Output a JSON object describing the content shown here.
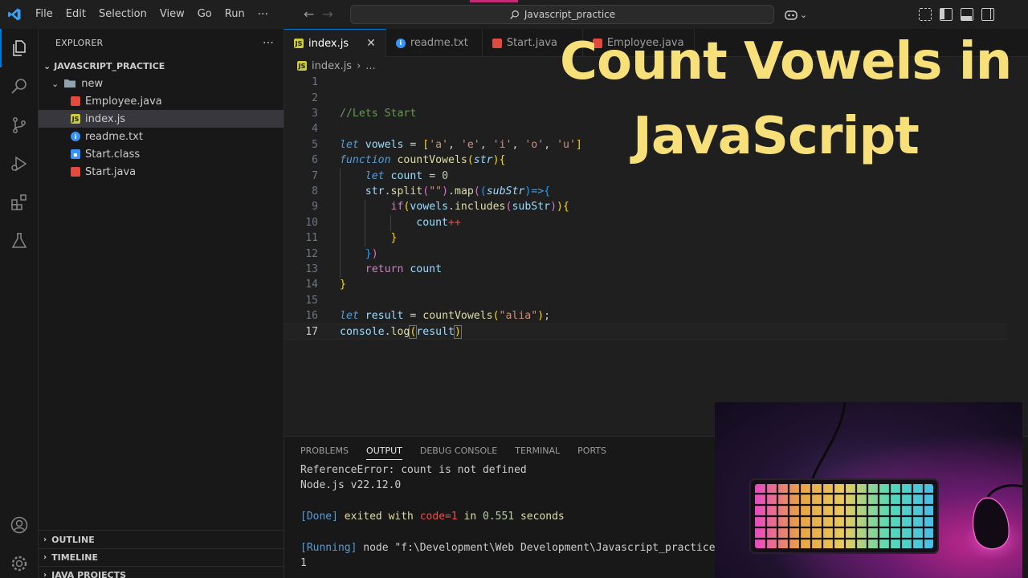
{
  "titlebar": {
    "menu": [
      "File",
      "Edit",
      "Selection",
      "View",
      "Go",
      "Run"
    ],
    "more": "···",
    "search": "Javascript_practice"
  },
  "sidebar": {
    "title": "EXPLORER",
    "more": "···",
    "project": "JAVASCRIPT_PRACTICE",
    "folder": "new",
    "files": [
      "Employee.java",
      "index.js",
      "readme.txt",
      "Start.class",
      "Start.java"
    ],
    "bottom_sections": [
      "OUTLINE",
      "TIMELINE",
      "JAVA PROJECTS"
    ]
  },
  "tabs": [
    "index.js",
    "readme.txt",
    "Start.java",
    "Employee.java"
  ],
  "breadcrumb": {
    "file": "index.js",
    "rest": "..."
  },
  "editor": {
    "line_numbers": [
      "1",
      "2",
      "3",
      "4",
      "5",
      "6",
      "7",
      "8",
      "9",
      "10",
      "11",
      "12",
      "13",
      "14",
      "15",
      "16",
      "17"
    ],
    "comment": "//Lets Start"
  },
  "overlay": {
    "line1": "Count Vowels in",
    "line2": "JavaScript"
  },
  "panel": {
    "tabs": [
      "PROBLEMS",
      "OUTPUT",
      "DEBUG CONSOLE",
      "TERMINAL",
      "PORTS"
    ],
    "out1": "ReferenceError: count is not defined",
    "out2": "Node.js v22.12.0",
    "done_tag": "[Done]",
    "done_text1": " exited with ",
    "done_code": "code=1",
    "done_text2": " in ",
    "done_time": "0.551",
    "done_text3": " seconds",
    "running_tag": "[Running]",
    "running_text": " node \"f:\\Development\\Web Development\\Javascript_practice",
    "result": "1"
  }
}
